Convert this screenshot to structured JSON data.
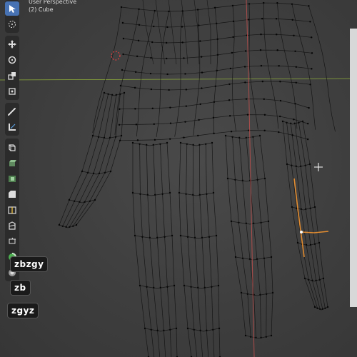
{
  "viewport": {
    "view_name": "User Perspective",
    "object_name": "(2) Cube"
  },
  "toolbar": {
    "tools": [
      {
        "name": "select-box",
        "icon": "cursor-icon",
        "active": true
      },
      {
        "name": "cursor",
        "icon": "3d-cursor-icon",
        "active": false
      },
      {
        "name": "move",
        "icon": "move-icon",
        "active": false
      },
      {
        "name": "rotate",
        "icon": "rotate-icon",
        "active": false
      },
      {
        "name": "scale",
        "icon": "scale-icon",
        "active": false
      },
      {
        "name": "transform",
        "icon": "transform-icon",
        "active": false
      },
      {
        "name": "annotate",
        "icon": "annotate-icon",
        "active": false
      },
      {
        "name": "measure",
        "icon": "measure-icon",
        "active": false
      },
      {
        "name": "add-cube",
        "icon": "add-cube-icon",
        "active": false
      },
      {
        "name": "extrude",
        "icon": "extrude-icon",
        "active": false
      },
      {
        "name": "inset",
        "icon": "inset-icon",
        "active": false
      },
      {
        "name": "bevel",
        "icon": "bevel-icon",
        "active": false
      },
      {
        "name": "loop-cut",
        "icon": "loop-cut-icon",
        "active": false
      },
      {
        "name": "knife",
        "icon": "knife-icon",
        "active": false
      },
      {
        "name": "poly-build",
        "icon": "poly-build-icon",
        "active": false
      },
      {
        "name": "spin",
        "icon": "spin-icon",
        "active": false
      },
      {
        "name": "smooth",
        "icon": "smooth-icon",
        "active": false
      }
    ]
  },
  "keystrokes": [
    "zbzgy",
    "zb",
    "zgyz"
  ],
  "colors": {
    "background": "#3d3d3d",
    "wire": "#0f0f0f",
    "selected_edge": "#ff9a2e",
    "x_axis": "#8fae3a",
    "y_axis": "#c0504d",
    "toolbar_bg": "#2b2b2b",
    "active_tool": "#4772b3"
  }
}
